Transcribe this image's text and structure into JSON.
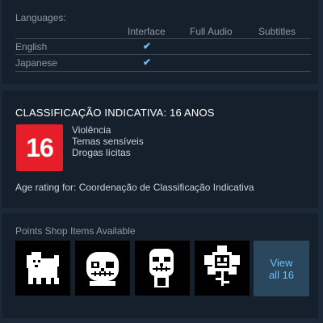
{
  "languages": {
    "title": "Languages:",
    "columns": [
      "Interface",
      "Full Audio",
      "Subtitles"
    ],
    "rows": [
      {
        "name": "English",
        "interface": "✔"
      },
      {
        "name": "Japanese",
        "interface": "✔"
      }
    ]
  },
  "rating": {
    "title": "CLASSIFICAÇÃO INDICATIVA: 16 ANOS",
    "badge": "16",
    "badge_color": "#e61e29",
    "descriptors": [
      "Violência",
      "Temas sensíveis",
      "Drogas lícitas"
    ],
    "agency": "Age rating for: Coordenação de Classificação Indicativa"
  },
  "points_shop": {
    "title": "Points Shop Items Available",
    "items": [
      {
        "icon": "annoying-dog-icon"
      },
      {
        "icon": "sans-skull-icon"
      },
      {
        "icon": "papyrus-skull-icon"
      },
      {
        "icon": "flowey-flower-icon"
      }
    ],
    "view_all_line1": "View",
    "view_all_line2": "all 16"
  },
  "colors": {
    "background": "#1b2838",
    "panel": "#16202d",
    "accent": "#67c1f5",
    "view_all_bg": "#2a475e"
  }
}
